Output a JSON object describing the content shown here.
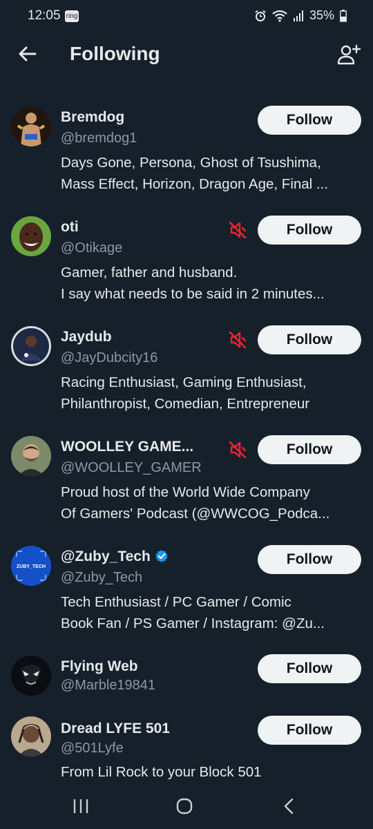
{
  "status_bar": {
    "time": "12:05",
    "ring_badge": "ring",
    "battery": "35%"
  },
  "header": {
    "title": "Following"
  },
  "accounts": [
    {
      "name": "Bremdog",
      "handle": "@bremdog1",
      "bio_lines": [
        "Days Gone, Persona, Ghost of Tsushima,",
        "Mass Effect, Horizon, Dragon Age, Final ..."
      ],
      "button": "Follow",
      "muted": false,
      "verified": false,
      "avatar_color": "#4a3a2a"
    },
    {
      "name": "oti",
      "handle": "@Otikage",
      "bio_lines": [
        "Gamer, father and husband.",
        "I say what needs to be said in 2 minutes..."
      ],
      "button": "Follow",
      "muted": true,
      "verified": false,
      "avatar_color": "#6aa63f"
    },
    {
      "name": "Jaydub",
      "handle": "@JayDubcity16",
      "bio_lines": [
        "Racing Enthusiast, Gaming Enthusiast,",
        "Philanthropist, Comedian, Entrepreneur"
      ],
      "button": "Follow",
      "muted": true,
      "verified": false,
      "avatar_color": "#1e2a44"
    },
    {
      "name": "WOOLLEY GAME...",
      "handle": "@WOOLLEY_GAMER",
      "bio_lines": [
        "Proud host of the World Wide Company",
        "Of Gamers' Podcast (@WWCOG_Podca..."
      ],
      "button": "Follow",
      "muted": true,
      "verified": false,
      "avatar_color": "#6b5a48"
    },
    {
      "name": "@Zuby_Tech",
      "handle": "@Zuby_Tech",
      "bio_lines": [
        "Tech Enthusiast / PC Gamer / Comic",
        "Book Fan / PS Gamer / Instagram: @Zu..."
      ],
      "button": "Follow",
      "muted": false,
      "verified": true,
      "avatar_color": "#1451c8",
      "avatar_text": "ZUBY_TECH"
    },
    {
      "name": "Flying Web",
      "handle": "@Marble19841",
      "bio_lines": [],
      "button": "Follow",
      "muted": false,
      "verified": false,
      "avatar_color": "#0b0d12"
    },
    {
      "name": "Dread LYFE 501",
      "handle": "@501Lyfe",
      "bio_lines": [
        "From Lil Rock to your Block 501"
      ],
      "button": "Follow",
      "muted": false,
      "verified": false,
      "avatar_color": "#8a7060"
    }
  ],
  "colors": {
    "background": "#15202b",
    "muted_red": "#f4212e",
    "verified_blue": "#1d9bf0",
    "secondary_text": "#8b98a5"
  }
}
